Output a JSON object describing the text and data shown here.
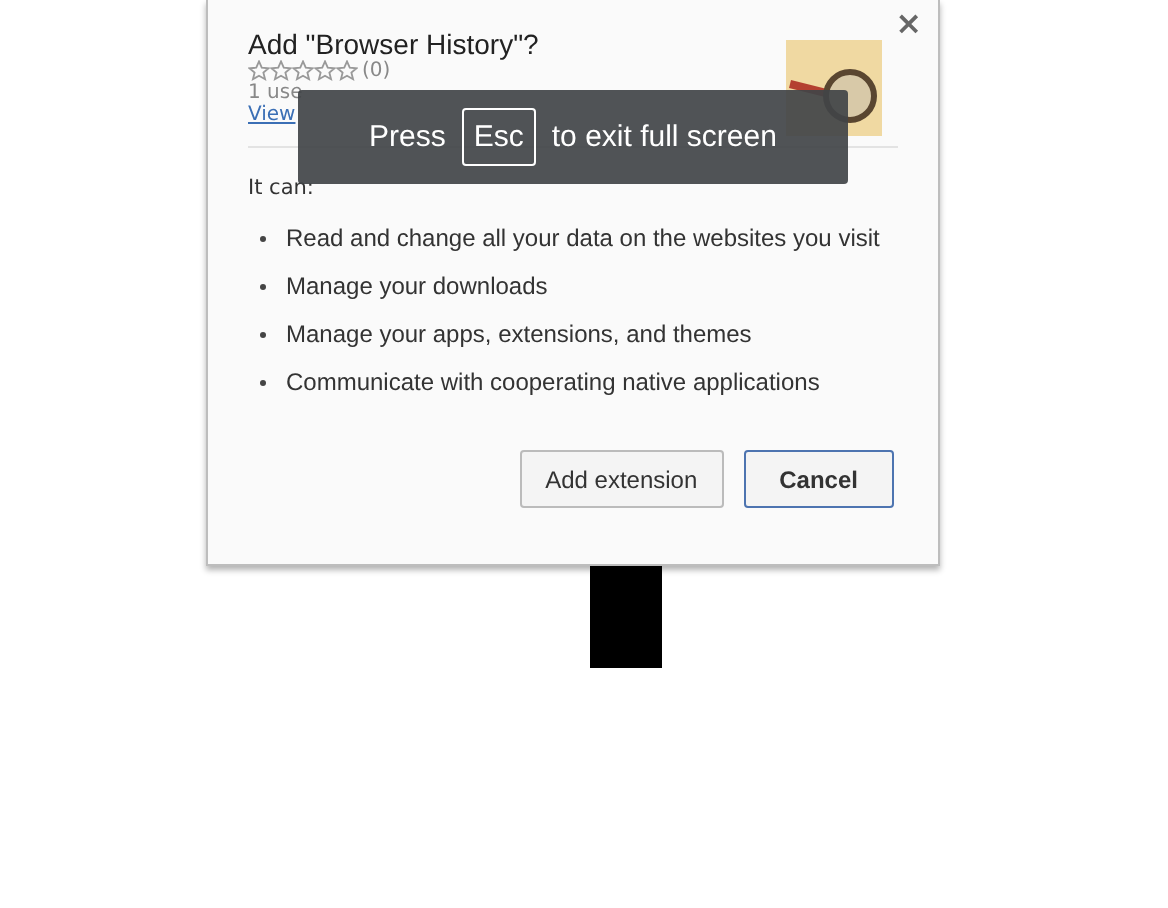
{
  "dialog": {
    "title": "Add \"Browser History\"?",
    "close": "×",
    "stars": 0,
    "rating_count": "(0)",
    "users": "1 use",
    "link": "View",
    "intro": "It can:",
    "permissions": [
      "Read and change all your data on the websites you visit",
      "Manage your downloads",
      "Manage your apps, extensions, and themes",
      "Communicate with cooperating native applications"
    ],
    "buttons": [
      {
        "label": "Add extension",
        "kind": "secondary"
      },
      {
        "label": "Cancel",
        "kind": "default"
      }
    ]
  },
  "fullscreen_notice": {
    "before": "Press",
    "key": "Esc",
    "after": "to exit full screen"
  }
}
